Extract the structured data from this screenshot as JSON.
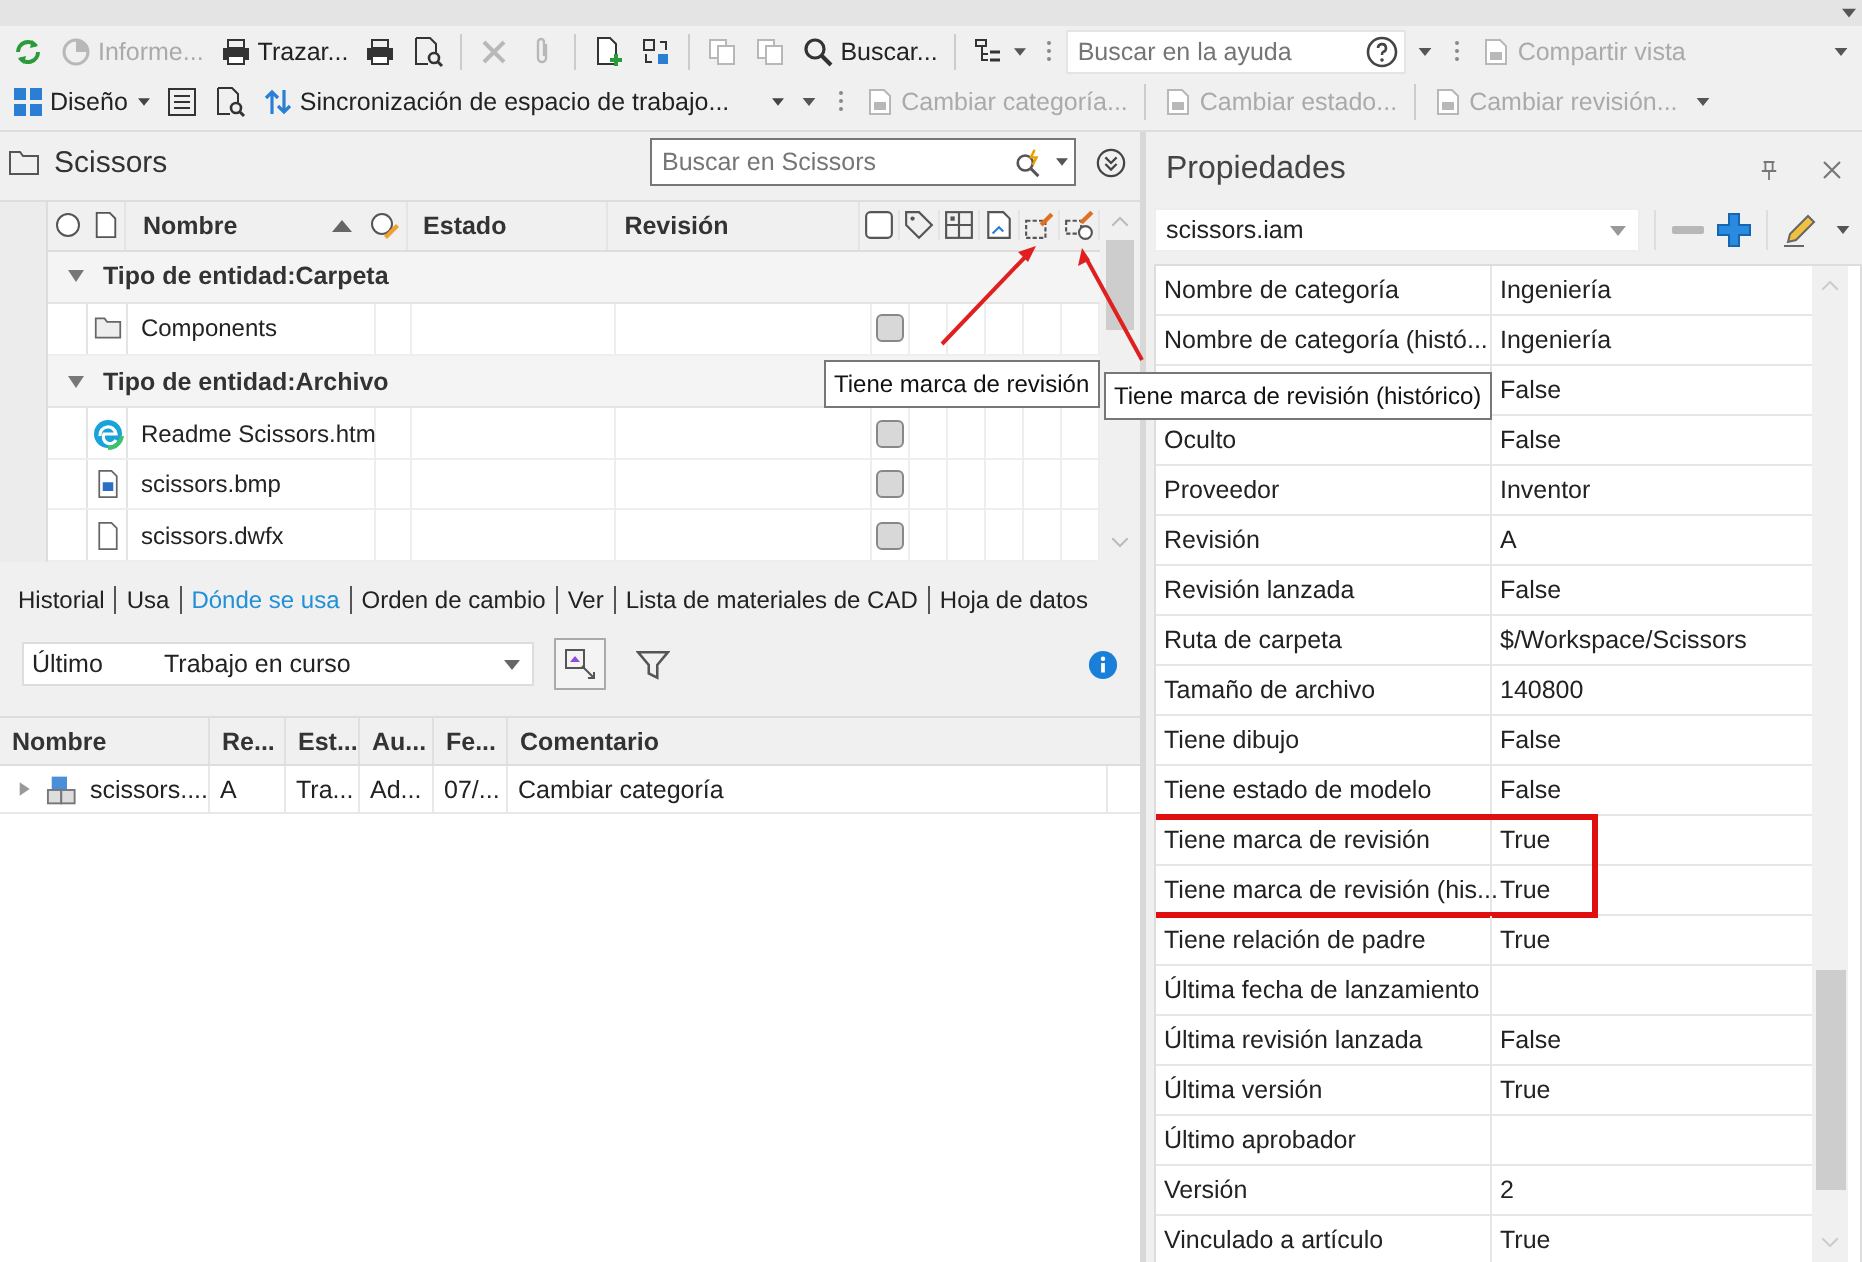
{
  "toolbar": {
    "rows": [
      [
        {
          "kind": "icon",
          "disabled": false
        },
        {
          "kind": "button",
          "label": "Informe...",
          "disabled": true
        },
        {
          "kind": "button",
          "label": "Trazar...",
          "disabled": false
        },
        {
          "kind": "icon",
          "disabled": false
        },
        {
          "kind": "icon",
          "disabled": false
        },
        {
          "kind": "separator"
        },
        {
          "kind": "icon",
          "disabled": true
        },
        {
          "kind": "icon",
          "disabled": true
        },
        {
          "kind": "separator"
        },
        {
          "kind": "icon",
          "disabled": false
        },
        {
          "kind": "icon",
          "disabled": false
        },
        {
          "kind": "separator"
        },
        {
          "kind": "icon",
          "disabled": true
        },
        {
          "kind": "icon",
          "disabled": true
        },
        {
          "kind": "button",
          "label": "Buscar...",
          "disabled": false
        },
        {
          "kind": "separator"
        },
        {
          "kind": "menu",
          "disabled": false
        },
        {
          "kind": "grip"
        },
        {
          "kind": "search",
          "placeholder": "Buscar en la ayuda"
        },
        {
          "kind": "caret"
        },
        {
          "kind": "grip"
        },
        {
          "kind": "button",
          "label": "Compartir vista",
          "disabled": true
        },
        {
          "kind": "spacer"
        },
        {
          "kind": "caret"
        }
      ],
      [
        {
          "kind": "menu-button",
          "label": "Diseño",
          "disabled": false
        },
        {
          "kind": "icon",
          "disabled": false
        },
        {
          "kind": "icon",
          "disabled": false
        },
        {
          "kind": "dropdown",
          "label": "Sincronización de espacio de trabajo...",
          "disabled": false
        },
        {
          "kind": "caret"
        },
        {
          "kind": "grip"
        },
        {
          "kind": "button",
          "label": "Cambiar categoría...",
          "disabled": true
        },
        {
          "kind": "separator"
        },
        {
          "kind": "button",
          "label": "Cambiar estado...",
          "disabled": true
        },
        {
          "kind": "separator"
        },
        {
          "kind": "button",
          "label": "Cambiar revisión...",
          "disabled": true
        },
        {
          "kind": "caret"
        }
      ]
    ]
  },
  "browser": {
    "title": "Scissors",
    "search": {
      "placeholder": "Buscar en Scissors"
    },
    "columns": [
      {
        "label": "Nombre",
        "sorted": true
      },
      {
        "label": "Estado",
        "sorted": false
      },
      {
        "label": "Revisión",
        "sorted": false
      }
    ],
    "groups": [
      {
        "label": "Tipo de entidad:Carpeta",
        "expanded": true,
        "rows": [
          {
            "name": "Components",
            "kind": "folder",
            "checked": false
          }
        ]
      },
      {
        "label": "Tipo de entidad:Archivo",
        "expanded": true,
        "rows": [
          {
            "name": "Readme Scissors.htm",
            "kind": "web",
            "checked": false
          },
          {
            "name": "scissors.bmp",
            "kind": "image",
            "checked": false
          },
          {
            "name": "scissors.dwfx",
            "kind": "document",
            "checked": false
          }
        ]
      }
    ],
    "tooltips": [
      "Tiene marca de revisión",
      "Tiene marca de revisión (histórico)"
    ]
  },
  "tabs": [
    {
      "label": "Historial",
      "selected": false
    },
    {
      "label": "Usa",
      "selected": false
    },
    {
      "label": "Dónde se usa",
      "selected": true
    },
    {
      "label": "Orden de cambio",
      "selected": false
    },
    {
      "label": "Ver",
      "selected": false
    },
    {
      "label": "Lista de materiales de CAD",
      "selected": false
    },
    {
      "label": "Hoja de datos",
      "selected": false
    }
  ],
  "filter": {
    "version": "Último",
    "state": "Trabajo en curso"
  },
  "uses_table": {
    "columns": [
      "Nombre",
      "Re...",
      "Est...",
      "Au...",
      "Fe...",
      "Comentario"
    ],
    "rows": [
      {
        "expanded": false,
        "cells": [
          "scissors....",
          "A",
          "Tra...",
          "Ad...",
          "07/...",
          "Cambiar categoría"
        ]
      }
    ]
  },
  "properties": {
    "title": "Propiedades",
    "file": "scissors.iam",
    "rows": [
      {
        "name": "Nombre de categoría",
        "value": "Ingeniería",
        "highlighted": false
      },
      {
        "name": "Nombre de categoría (histó...",
        "value": "Ingeniería",
        "highlighted": false
      },
      {
        "value": "False",
        "highlighted": false
      },
      {
        "name": "Oculto",
        "value": "False",
        "highlighted": false
      },
      {
        "name": "Proveedor",
        "value": "Inventor",
        "highlighted": false
      },
      {
        "name": "Revisión",
        "value": "A",
        "highlighted": false
      },
      {
        "name": "Revisión lanzada",
        "value": "False",
        "highlighted": false
      },
      {
        "name": "Ruta de carpeta",
        "value": "$/Workspace/Scissors",
        "highlighted": false
      },
      {
        "name": "Tamaño de archivo",
        "value": "140800",
        "highlighted": false
      },
      {
        "name": "Tiene dibujo",
        "value": "False",
        "highlighted": false
      },
      {
        "name": "Tiene estado de modelo",
        "value": "False",
        "highlighted": false
      },
      {
        "name": "Tiene marca de revisión",
        "value": "True",
        "highlighted": true
      },
      {
        "name": "Tiene marca de revisión (his...",
        "value": "True",
        "highlighted": true
      },
      {
        "name": "Tiene relación de padre",
        "value": "True",
        "highlighted": false
      },
      {
        "name": "Última fecha de lanzamiento",
        "highlighted": false
      },
      {
        "name": "Última revisión lanzada",
        "value": "False",
        "highlighted": false
      },
      {
        "name": "Última versión",
        "value": "True",
        "highlighted": false
      },
      {
        "name": "Último aprobador",
        "highlighted": false
      },
      {
        "name": "Versión",
        "value": "2",
        "highlighted": false
      },
      {
        "name": "Vinculado a artículo",
        "value": "True",
        "highlighted": false
      }
    ]
  }
}
